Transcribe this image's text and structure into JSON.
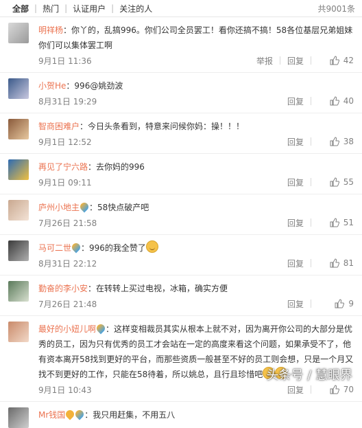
{
  "tabs": [
    {
      "label": "全部",
      "active": true
    },
    {
      "label": "热门"
    },
    {
      "label": "认证用户"
    },
    {
      "label": "关注的人"
    }
  ],
  "total": "共9001条",
  "comments": [
    {
      "name": "明祥杨",
      "text": "：你丫的，乱搞996。你们公司全员罢工！看你还搞不搞！58各位基层兄弟姐妹你们可以集体罢工啊",
      "time": "9月1日 11:36",
      "report": "举报",
      "reply": "回复",
      "likes": "42"
    },
    {
      "name": "小贺He",
      "text": "：996@姚劲波",
      "time": "8月31日 19:29",
      "reply": "回复",
      "likes": "40"
    },
    {
      "name": "智商困难户",
      "text": "：今日头条看到，特意来问候你妈：操！！！",
      "time": "9月1日 12:52",
      "reply": "回复",
      "likes": "38"
    },
    {
      "name": "再见了宁六路",
      "text": "：去你妈的996",
      "time": "9月1日 09:11",
      "reply": "回复",
      "likes": "55"
    },
    {
      "name": "庐州小地主",
      "text": "：58快点破产吧",
      "time": "7月26日 21:58",
      "reply": "回复",
      "likes": "51"
    },
    {
      "name": "马可二世",
      "text": "：996的我全赞了",
      "time": "8月31日 22:12",
      "reply": "回复",
      "likes": "81"
    },
    {
      "name": "勤奋的李小安",
      "text": "：在转转上买过电视，冰箱，确实方便",
      "time": "7月26日 21:48",
      "reply": "回复",
      "likes": "9"
    },
    {
      "name": "最好的小妞儿啊",
      "text": "：这样变相裁员其实从根本上就不对，因为离开你公司的大部分是优秀的员工，因为只有优秀的员工才会站在一定的高度来看这个问题，如果承受不了，他有资本离开58找到更好的平台，而那些资质一般甚至不好的员工则会想，只是一个月又找不到更好的工作，只能在58待着，所以姚总，且行且珍惜吧",
      "time": "9月1日 10:43",
      "reply": "回复",
      "likes": "70"
    },
    {
      "name": "Mr钱国",
      "text": "：我只用赶集，不用五八",
      "time": "",
      "reply": "",
      "likes": ""
    }
  ],
  "watermark": "头条号 / 慧眼界",
  "colors": {
    "name": "#eb7350",
    "muted": "#808080",
    "text": "#333333"
  }
}
